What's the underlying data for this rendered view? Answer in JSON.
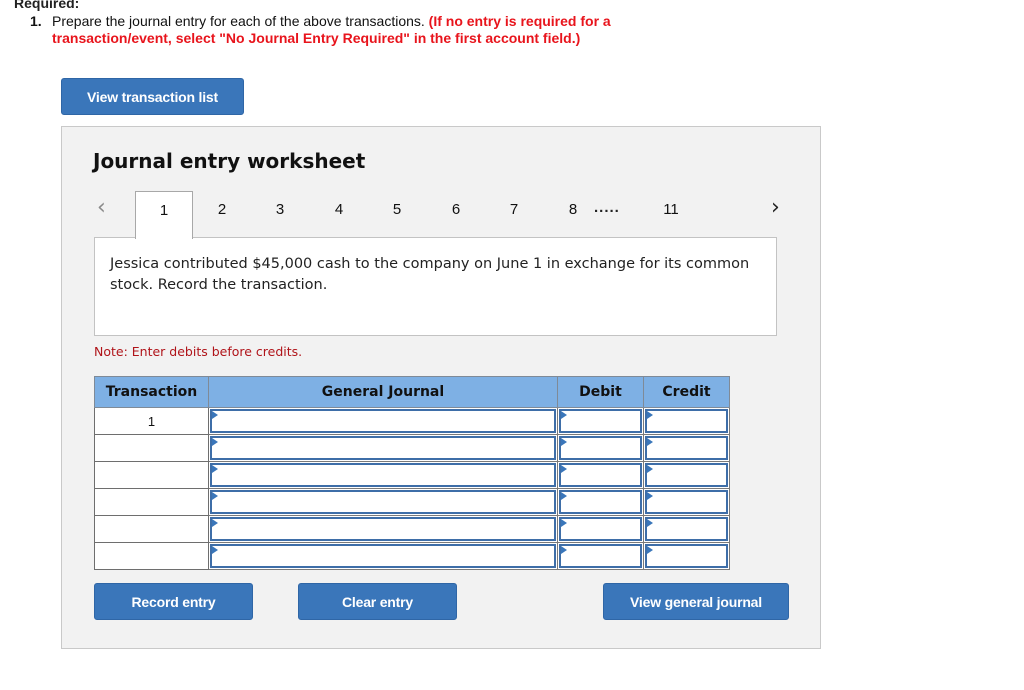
{
  "required": {
    "heading": "Required:",
    "item_number": "1.",
    "instruction_text": "Prepare the journal entry for each of the above transactions.",
    "instruction_red_line1": "(If no entry is required for a",
    "instruction_red_line2": "transaction/event, select \"No Journal Entry Required\" in the first account field.)"
  },
  "buttons": {
    "view_transaction_list": "View transaction list",
    "record_entry": "Record entry",
    "clear_entry": "Clear entry",
    "view_general_journal": "View general journal"
  },
  "worksheet": {
    "title": "Journal entry worksheet",
    "nav_prev_icon": "‹",
    "nav_next_icon": "›",
    "tabs": [
      "1",
      "2",
      "3",
      "4",
      "5",
      "6",
      "7",
      "8",
      "11"
    ],
    "active_tab": "1",
    "ellipsis": ".....",
    "description": "Jessica contributed $45,000 cash to the company on June 1 in exchange for its common stock. Record the transaction.",
    "note": "Note: Enter debits before credits."
  },
  "journal_table": {
    "headers": {
      "transaction": "Transaction",
      "general_journal": "General Journal",
      "debit": "Debit",
      "credit": "Credit"
    },
    "rows": [
      {
        "transaction": "1",
        "account": "",
        "debit": "",
        "credit": ""
      },
      {
        "transaction": "",
        "account": "",
        "debit": "",
        "credit": ""
      },
      {
        "transaction": "",
        "account": "",
        "debit": "",
        "credit": ""
      },
      {
        "transaction": "",
        "account": "",
        "debit": "",
        "credit": ""
      },
      {
        "transaction": "",
        "account": "",
        "debit": "",
        "credit": ""
      },
      {
        "transaction": "",
        "account": "",
        "debit": "",
        "credit": ""
      }
    ]
  },
  "colors": {
    "button_blue": "#3a76ba",
    "header_blue": "#7eb0e4",
    "instruction_red": "#e8141c",
    "note_red": "#b0141a",
    "panel_bg": "#f2f2f2"
  }
}
